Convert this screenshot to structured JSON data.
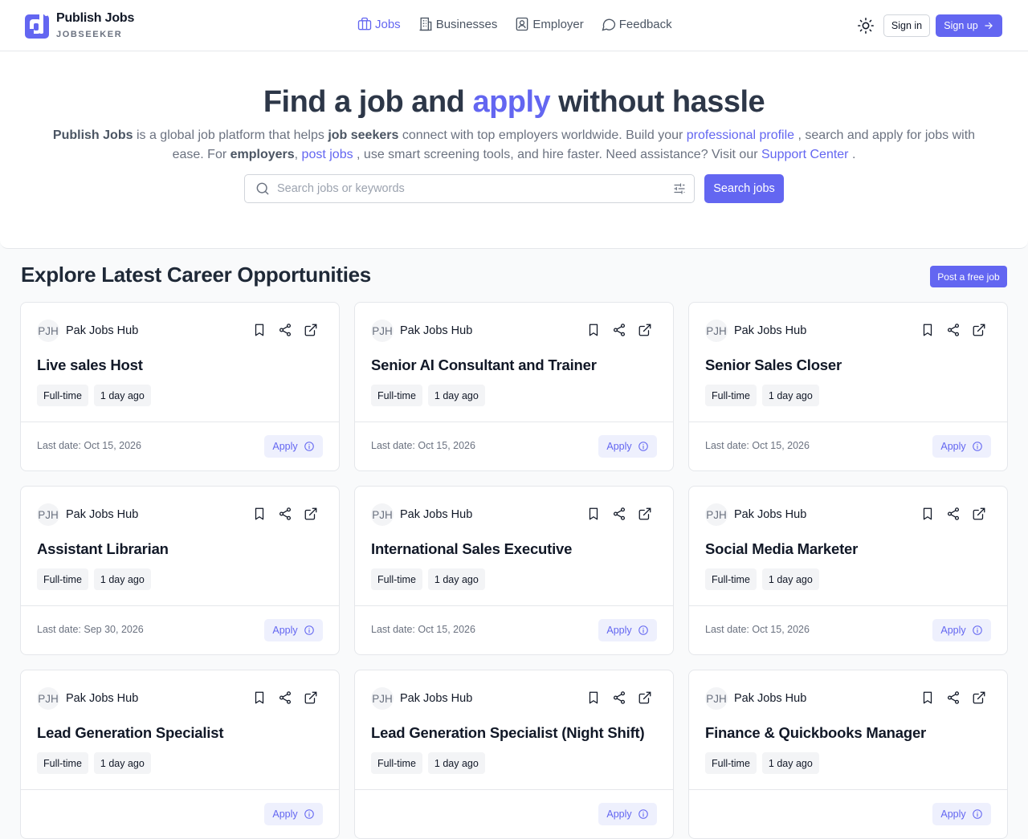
{
  "header": {
    "brand_name": "Publish Jobs",
    "brand_sub": "JOBSEEKER",
    "nav": [
      {
        "label": "Jobs",
        "icon": "briefcase-icon",
        "active": true
      },
      {
        "label": "Businesses",
        "icon": "building-icon"
      },
      {
        "label": "Employer",
        "icon": "id-card-icon"
      },
      {
        "label": "Feedback",
        "icon": "message-circle-icon"
      }
    ],
    "theme_icon": "sun-icon",
    "signin_label": "Sign in",
    "signup_label": "Sign up"
  },
  "hero": {
    "title_pre": "Find a job and ",
    "title_highlight": "apply",
    "title_post": " without hassle",
    "desc": {
      "brand": "Publish Jobs",
      "t1": " is a global job platform that helps ",
      "job_seekers": "job seekers",
      "t2": " connect with top employers worldwide. Build your ",
      "professional_profile": "professional profile",
      "t3": " , search and apply for jobs with ease. For ",
      "employers": "employers",
      "t4": ", ",
      "post_jobs": "post jobs",
      "t5": " , use smart screening tools, and hire faster. Need assistance? Visit our ",
      "support_center": "Support Center",
      "t6": " ."
    },
    "search_placeholder": "Search jobs or keywords",
    "search_button": "Search jobs"
  },
  "section": {
    "title": "Explore Latest Career Opportunities",
    "post_button": "Post a free job"
  },
  "jobs": [
    {
      "avatar": "PJH",
      "company": "Pak Jobs Hub",
      "title": "Live sales Host",
      "type": "Full-time",
      "posted": "1 day ago",
      "last_date": "Last date: Oct 15, 2026",
      "apply": "Apply"
    },
    {
      "avatar": "PJH",
      "company": "Pak Jobs Hub",
      "title": "Senior AI Consultant and Trainer",
      "type": "Full-time",
      "posted": "1 day ago",
      "last_date": "Last date: Oct 15, 2026",
      "apply": "Apply"
    },
    {
      "avatar": "PJH",
      "company": "Pak Jobs Hub",
      "title": "Senior Sales Closer",
      "type": "Full-time",
      "posted": "1 day ago",
      "last_date": "Last date: Oct 15, 2026",
      "apply": "Apply"
    },
    {
      "avatar": "PJH",
      "company": "Pak Jobs Hub",
      "title": "Assistant Librarian",
      "type": "Full-time",
      "posted": "1 day ago",
      "last_date": "Last date: Sep 30, 2026",
      "apply": "Apply"
    },
    {
      "avatar": "PJH",
      "company": "Pak Jobs Hub",
      "title": "International Sales Executive",
      "type": "Full-time",
      "posted": "1 day ago",
      "last_date": "Last date: Oct 15, 2026",
      "apply": "Apply"
    },
    {
      "avatar": "PJH",
      "company": "Pak Jobs Hub",
      "title": "Social Media Marketer",
      "type": "Full-time",
      "posted": "1 day ago",
      "last_date": "Last date: Oct 15, 2026",
      "apply": "Apply"
    },
    {
      "avatar": "PJH",
      "company": "Pak Jobs Hub",
      "title": "Lead Generation Specialist",
      "type": "Full-time",
      "posted": "1 day ago",
      "last_date": "",
      "apply": "Apply"
    },
    {
      "avatar": "PJH",
      "company": "Pak Jobs Hub",
      "title": "Lead Generation Specialist (Night Shift)",
      "type": "Full-time",
      "posted": "1 day ago",
      "last_date": "",
      "apply": "Apply"
    },
    {
      "avatar": "PJH",
      "company": "Pak Jobs Hub",
      "title": "Finance & Quickbooks Manager",
      "type": "Full-time",
      "posted": "1 day ago",
      "last_date": "",
      "apply": "Apply"
    }
  ],
  "colors": {
    "accent": "#6366f1",
    "text": "#111827",
    "muted": "#6b7280",
    "border": "#e5e7eb"
  }
}
